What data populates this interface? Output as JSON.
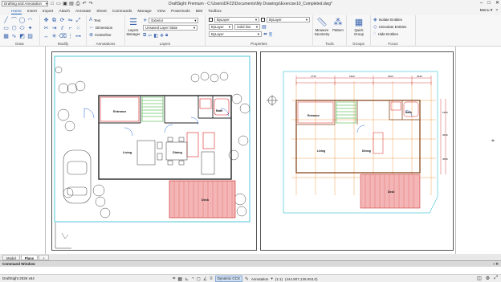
{
  "titlebar": {
    "workspace": "Drafting and Annotation",
    "title": "DraftSight Premium - C:\\Users\\DFZ2\\Documents\\My Drawings\\Exercise10_Completed.dwg*",
    "window_buttons": [
      "–",
      "□",
      "✕"
    ]
  },
  "menubar": {
    "items": [
      "Home",
      "Insert",
      "Import",
      "Attach",
      "Annotate",
      "Sheet",
      "Commands",
      "Manage",
      "View",
      "Powertools",
      "BIM",
      "Toolbox"
    ],
    "right": [
      "Menu ▾",
      "?"
    ]
  },
  "ribbon": {
    "groups": {
      "draw": "Draw",
      "modify": "Modify",
      "annotations": "Annotations",
      "layers": "Layers",
      "properties": "Properties",
      "tools": "Tools",
      "groups": "Groups",
      "focus": "Focus"
    },
    "annotation_items": [
      "Text",
      "Dimension",
      "Centerline"
    ],
    "layers_manager": "Layers Manager",
    "layer_name": "Exterior",
    "layer_state": "Unsaved Layer State",
    "prop_color": "ByLayer",
    "prop_color2": "ByLayer",
    "prop_linetype": "ByLayer",
    "prop_linestyle": "Solid line",
    "prop_lineweight": "ByLayer",
    "tools_measure": "Measure Geometry",
    "tools_pattern": "Pattern",
    "groups_quick": "Quick Group",
    "focus_items": [
      "Isolate Entities",
      "Unisolate Entities",
      "Hide Entities"
    ]
  },
  "drawing": {
    "left_rooms": [
      "Entrance",
      "Bath",
      "Living",
      "Dining",
      "Deck"
    ],
    "right_rooms": [
      "Entrance",
      "Bath",
      "Living",
      "Dining",
      "Deck"
    ],
    "dims_top": [
      "2730",
      "1820",
      "1820",
      "3640"
    ],
    "dims_left": [
      "1820",
      "3640",
      "4550"
    ]
  },
  "tabs": [
    "Model",
    "Plans",
    "+"
  ],
  "command_window": {
    "label": "Command Window",
    "controls": "▪ ✕"
  },
  "status": {
    "app": "DraftSight 2026 x64",
    "dynamic_ccs": "Dynamic CCS",
    "annotation": "Annotation",
    "scale": "(1:1)",
    "coords": "(444.807,139.653,0)"
  }
}
